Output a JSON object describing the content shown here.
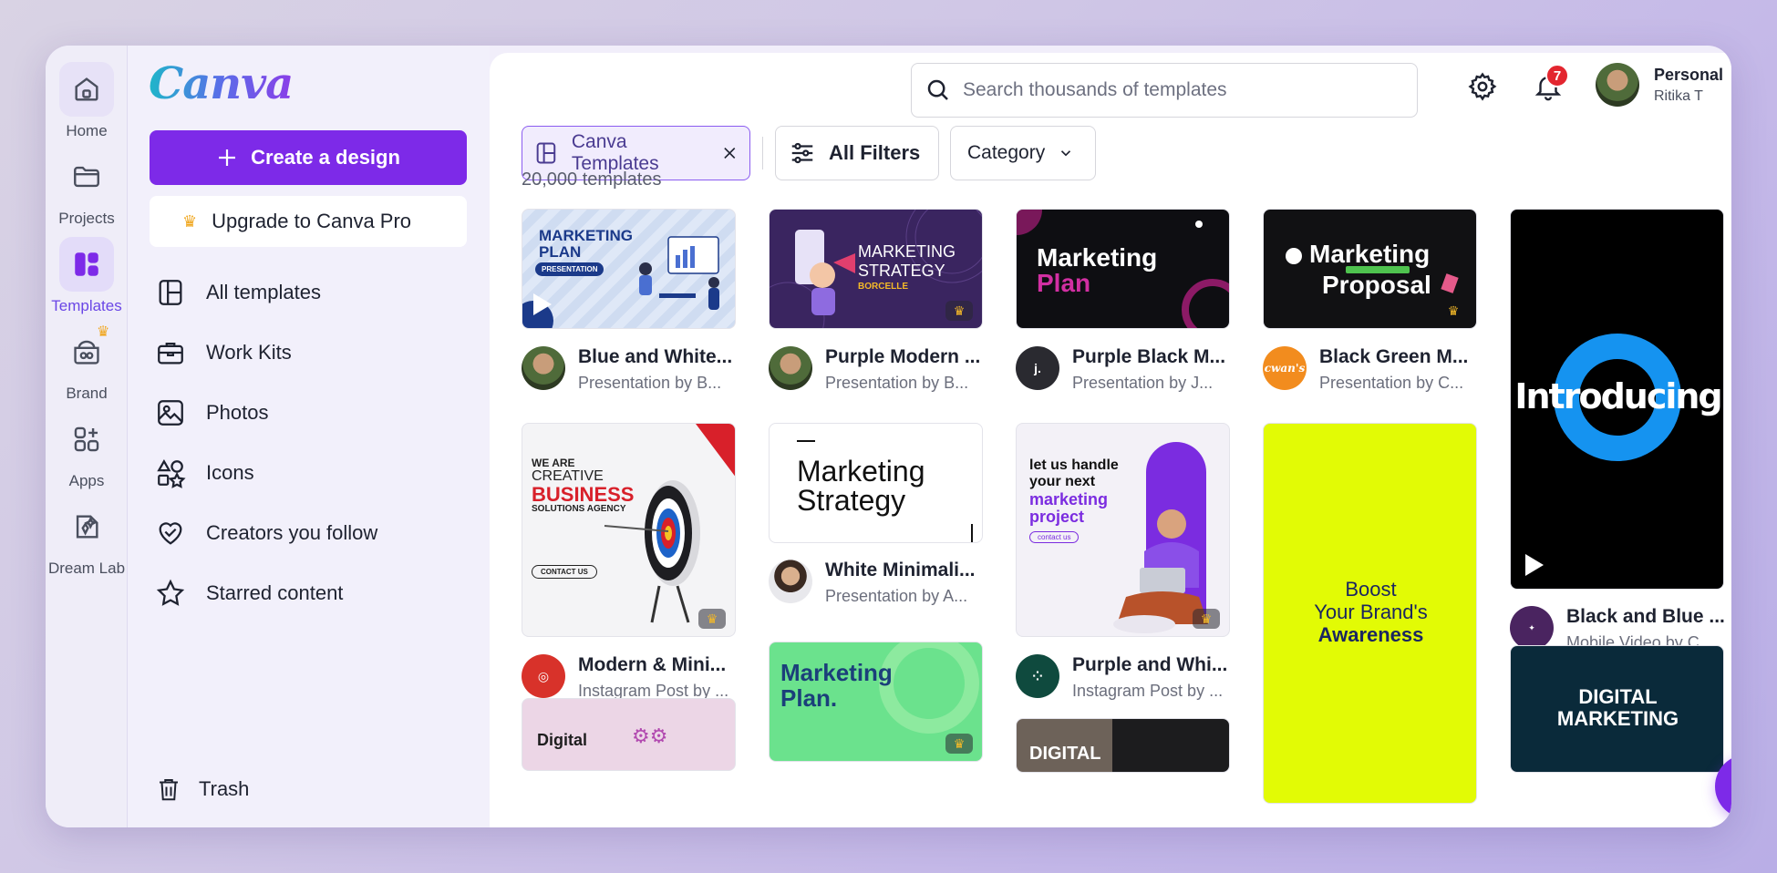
{
  "rail": {
    "home": "Home",
    "projects": "Projects",
    "templates": "Templates",
    "brand": "Brand",
    "apps": "Apps",
    "dream_lab": "Dream Lab"
  },
  "sidebar": {
    "logo": "Canva",
    "create_label": "Create a design",
    "upgrade_label": "Upgrade to Canva Pro",
    "items": [
      {
        "label": "All templates"
      },
      {
        "label": "Work Kits"
      },
      {
        "label": "Photos"
      },
      {
        "label": "Icons"
      },
      {
        "label": "Creators you follow"
      },
      {
        "label": "Starred content"
      }
    ],
    "trash_label": "Trash"
  },
  "header": {
    "search_placeholder": "Search thousands of templates",
    "notification_count": "7",
    "account_type": "Personal",
    "account_user": "Ritika T"
  },
  "filters": {
    "chip_label": "Canva Templates",
    "all_filters": "All Filters",
    "category": "Category",
    "count": "20,000 templates"
  },
  "cards": [
    {
      "title": "Blue and White...",
      "subtitle": "Presentation by B...",
      "thumb_line1": "MARKETING",
      "thumb_line2": "PLAN",
      "thumb_tag": "PRESENTATION"
    },
    {
      "title": "Purple Modern ...",
      "subtitle": "Presentation by B...",
      "thumb_line1": "MARKETING",
      "thumb_line2": "STRATEGY",
      "thumb_tag": "BORCELLE"
    },
    {
      "title": "Purple Black M...",
      "subtitle": "Presentation by J...",
      "thumb_line1": "Marketing",
      "thumb_line2": "Plan",
      "avatar_text": "j."
    },
    {
      "title": "Black Green M...",
      "subtitle": "Presentation by C...",
      "thumb_line1": "Marketing",
      "thumb_line2": "Proposal",
      "avatar_text": "cwan's"
    },
    {
      "title": "Black and Blue ...",
      "subtitle": "Mobile Video by C...",
      "thumb_line1": "Introducing"
    },
    {
      "title": "Modern & Mini...",
      "subtitle": "Instagram Post by ...",
      "thumb_line1": "WE ARE",
      "thumb_line2": "CREATIVE",
      "thumb_line3": "BUSINESS",
      "thumb_line4": "SOLUTIONS AGENCY",
      "thumb_tag": "CONTACT US"
    },
    {
      "title": "White Minimali...",
      "subtitle": "Presentation by A...",
      "thumb_line1": "Marketing",
      "thumb_line2": "Strategy"
    },
    {
      "title": "Purple and Whi...",
      "subtitle": "Instagram Post by ...",
      "thumb_line1": "let us handle",
      "thumb_line2": "your next",
      "thumb_line3": "marketing",
      "thumb_line4": "project",
      "thumb_tag": "contact us"
    },
    {
      "thumb_line1": "Boost",
      "thumb_line2": "Your Brand's",
      "thumb_line3": "Awareness"
    },
    {
      "thumb_line1": "Marketing",
      "thumb_line2": "Plan."
    },
    {
      "thumb_line1": "DIGITAL",
      "thumb_line2": "MARKETING"
    },
    {
      "thumb_line1": "DIGITAL"
    },
    {
      "thumb_line1": "Digital"
    }
  ],
  "help_label": "?"
}
